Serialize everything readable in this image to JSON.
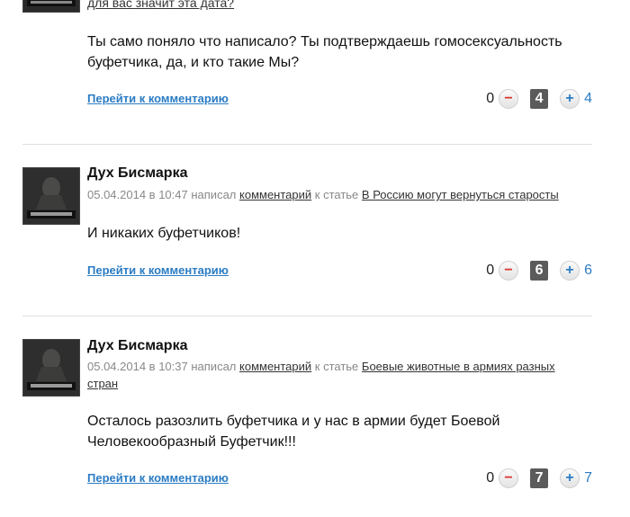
{
  "comments": [
    {
      "meta_top_link": "для вас значит эта дата?",
      "text": "Ты само поняло что написало? Ты подтверждаешь гомосексуальность буфетчика, да, и кто такие Мы?",
      "goto_label": "Перейти к комментарию",
      "votes": {
        "minus": "0",
        "score": "4",
        "plus": "4"
      }
    },
    {
      "author": "Дух Бисмарка",
      "date": "05.04.2014 в 10:47",
      "wrote": "написал",
      "comment_link": "комментарий",
      "to_article": "к статье",
      "article_link": "В Россию могут вернуться старосты",
      "text": "И никаких буфетчиков!",
      "goto_label": "Перейти к комментарию",
      "votes": {
        "minus": "0",
        "score": "6",
        "plus": "6"
      }
    },
    {
      "author": "Дух Бисмарка",
      "date": "05.04.2014 в 10:37",
      "wrote": "написал",
      "comment_link": "комментарий",
      "to_article": "к статье",
      "article_link": "Боевые животные в армиях разных стран",
      "text": "Осталось разозлить буфетчика и у нас в армии будет Боевой Человекообразный Буфетчик!!!",
      "goto_label": "Перейти к комментарию",
      "votes": {
        "minus": "0",
        "score": "7",
        "plus": "7"
      }
    }
  ],
  "icons": {
    "minus": "minus-circle-icon",
    "plus": "plus-circle-icon",
    "minus_glyph": "−",
    "plus_glyph": "+"
  },
  "colors": {
    "link": "#2b7cc4",
    "minus": "#d9352e",
    "score_bg": "#5b5b5b",
    "divider": "#e0e0e0"
  }
}
